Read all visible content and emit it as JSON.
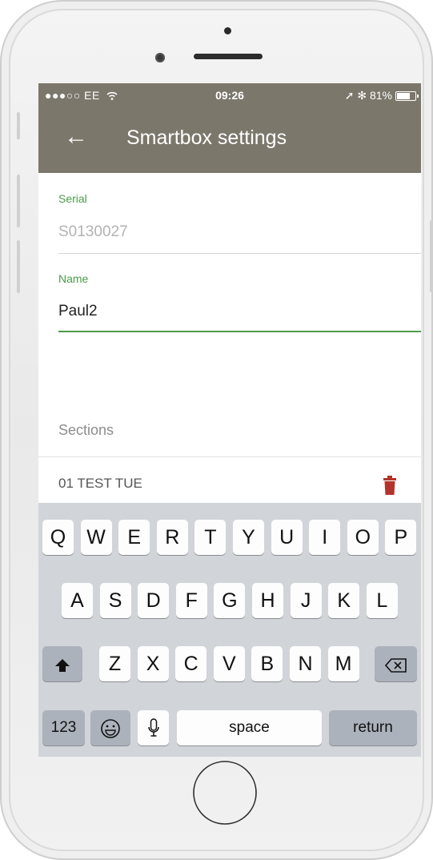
{
  "status_bar": {
    "carrier": "●●●○○ EE",
    "wifi_icon": "wifi-icon",
    "time": "09:26",
    "right_text": "➚ ✻ 81%",
    "battery_level": 0.81
  },
  "app_bar": {
    "back_icon": "←",
    "title": "Smartbox settings"
  },
  "form": {
    "serial_label": "Serial",
    "serial_value": "S0130027",
    "name_label": "Name",
    "name_value": "Paul2"
  },
  "sections": {
    "label": "Sections",
    "items": [
      {
        "label": "01 TEST TUE",
        "action_icon": "trash-icon"
      }
    ]
  },
  "keyboard": {
    "row1": [
      "Q",
      "W",
      "E",
      "R",
      "T",
      "Y",
      "U",
      "I",
      "O",
      "P"
    ],
    "row2": [
      "A",
      "S",
      "D",
      "F",
      "G",
      "H",
      "J",
      "K",
      "L"
    ],
    "row3": [
      "Z",
      "X",
      "C",
      "V",
      "B",
      "N",
      "M"
    ],
    "shift_icon": "shift-icon",
    "backspace_icon": "backspace-icon",
    "numbers_label": "123",
    "emoji_icon": "emoji-icon",
    "mic_icon": "mic-icon",
    "space_label": "space",
    "return_label": "return"
  },
  "colors": {
    "header": "#7c776b",
    "accent_green": "#4b9a4b",
    "delete_red": "#b3342c",
    "keyboard_bg": "#d1d4d9"
  }
}
